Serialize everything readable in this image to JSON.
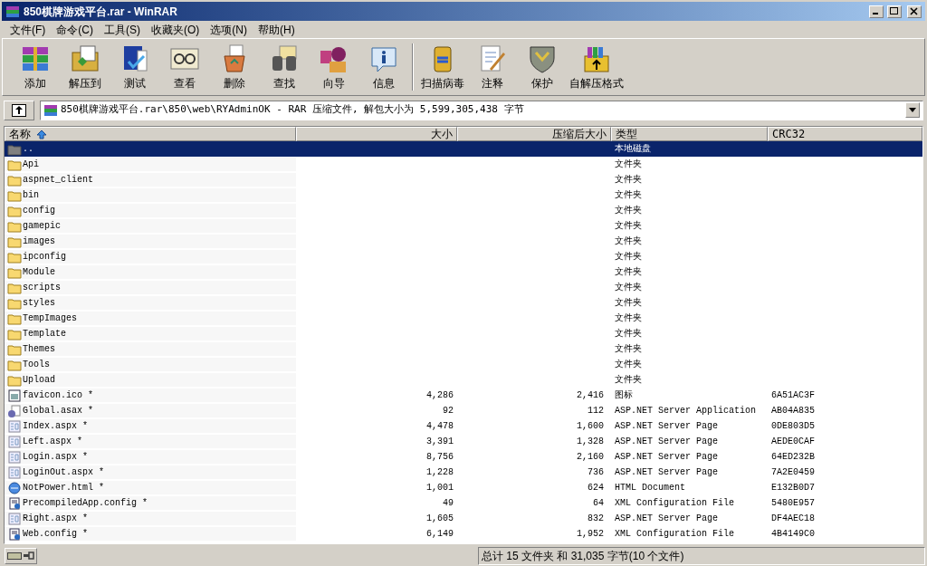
{
  "window": {
    "title": "850棋牌游戏平台.rar - WinRAR"
  },
  "menu": [
    "文件(F)",
    "命令(C)",
    "工具(S)",
    "收藏夹(O)",
    "选项(N)",
    "帮助(H)"
  ],
  "toolbar": [
    [
      {
        "label": "添加",
        "kind": "add"
      },
      {
        "label": "解压到",
        "kind": "extract"
      },
      {
        "label": "测试",
        "kind": "test"
      },
      {
        "label": "查看",
        "kind": "view"
      },
      {
        "label": "删除",
        "kind": "delete"
      },
      {
        "label": "查找",
        "kind": "find"
      },
      {
        "label": "向导",
        "kind": "wizard"
      },
      {
        "label": "信息",
        "kind": "info"
      }
    ],
    [
      {
        "label": "扫描病毒",
        "kind": "scan"
      },
      {
        "label": "注释",
        "kind": "comment"
      },
      {
        "label": "保护",
        "kind": "protect"
      },
      {
        "label": "自解压格式",
        "kind": "sfx"
      }
    ]
  ],
  "path": "850棋牌游戏平台.rar\\850\\web\\RYAdminOK - RAR 压缩文件, 解包大小为 5,599,305,438 字节",
  "table": {
    "columns": [
      "名称",
      "大小",
      "压缩后大小",
      "类型",
      "CRC32"
    ],
    "rows": [
      {
        "kind": "up",
        "name": "..",
        "size": "",
        "packed": "",
        "type": "本地磁盘",
        "crc": "",
        "selected": true
      },
      {
        "kind": "folder",
        "name": "Api",
        "size": "",
        "packed": "",
        "type": "文件夹",
        "crc": "",
        "selected": false
      },
      {
        "kind": "folder",
        "name": "aspnet_client",
        "size": "",
        "packed": "",
        "type": "文件夹",
        "crc": "",
        "selected": false
      },
      {
        "kind": "folder",
        "name": "bin",
        "size": "",
        "packed": "",
        "type": "文件夹",
        "crc": "",
        "selected": false
      },
      {
        "kind": "folder",
        "name": "config",
        "size": "",
        "packed": "",
        "type": "文件夹",
        "crc": "",
        "selected": false
      },
      {
        "kind": "folder",
        "name": "gamepic",
        "size": "",
        "packed": "",
        "type": "文件夹",
        "crc": "",
        "selected": false
      },
      {
        "kind": "folder",
        "name": "images",
        "size": "",
        "packed": "",
        "type": "文件夹",
        "crc": "",
        "selected": false
      },
      {
        "kind": "folder",
        "name": "ipconfig",
        "size": "",
        "packed": "",
        "type": "文件夹",
        "crc": "",
        "selected": false
      },
      {
        "kind": "folder",
        "name": "Module",
        "size": "",
        "packed": "",
        "type": "文件夹",
        "crc": "",
        "selected": false
      },
      {
        "kind": "folder",
        "name": "scripts",
        "size": "",
        "packed": "",
        "type": "文件夹",
        "crc": "",
        "selected": false
      },
      {
        "kind": "folder",
        "name": "styles",
        "size": "",
        "packed": "",
        "type": "文件夹",
        "crc": "",
        "selected": false
      },
      {
        "kind": "folder",
        "name": "TempImages",
        "size": "",
        "packed": "",
        "type": "文件夹",
        "crc": "",
        "selected": false
      },
      {
        "kind": "folder",
        "name": "Template",
        "size": "",
        "packed": "",
        "type": "文件夹",
        "crc": "",
        "selected": false
      },
      {
        "kind": "folder",
        "name": "Themes",
        "size": "",
        "packed": "",
        "type": "文件夹",
        "crc": "",
        "selected": false
      },
      {
        "kind": "folder",
        "name": "Tools",
        "size": "",
        "packed": "",
        "type": "文件夹",
        "crc": "",
        "selected": false
      },
      {
        "kind": "folder",
        "name": "Upload",
        "size": "",
        "packed": "",
        "type": "文件夹",
        "crc": "",
        "selected": false
      },
      {
        "kind": "ico",
        "name": "favicon.ico *",
        "size": "4,286",
        "packed": "2,416",
        "type": "图标",
        "crc": "6A51AC3F",
        "selected": false
      },
      {
        "kind": "asax",
        "name": "Global.asax *",
        "size": "92",
        "packed": "112",
        "type": "ASP.NET Server Application",
        "crc": "AB04A835",
        "selected": false
      },
      {
        "kind": "aspx",
        "name": "Index.aspx *",
        "size": "4,478",
        "packed": "1,600",
        "type": "ASP.NET Server Page",
        "crc": "0DE803D5",
        "selected": false
      },
      {
        "kind": "aspx",
        "name": "Left.aspx *",
        "size": "3,391",
        "packed": "1,328",
        "type": "ASP.NET Server Page",
        "crc": "AEDE0CAF",
        "selected": false
      },
      {
        "kind": "aspx",
        "name": "Login.aspx *",
        "size": "8,756",
        "packed": "2,160",
        "type": "ASP.NET Server Page",
        "crc": "64ED232B",
        "selected": false
      },
      {
        "kind": "aspx",
        "name": "LoginOut.aspx *",
        "size": "1,228",
        "packed": "736",
        "type": "ASP.NET Server Page",
        "crc": "7A2E0459",
        "selected": false
      },
      {
        "kind": "html",
        "name": "NotPower.html *",
        "size": "1,001",
        "packed": "624",
        "type": "HTML Document",
        "crc": "E132B0D7",
        "selected": false
      },
      {
        "kind": "config",
        "name": "PrecompiledApp.config *",
        "size": "49",
        "packed": "64",
        "type": "XML Configuration File",
        "crc": "5480E957",
        "selected": false
      },
      {
        "kind": "aspx",
        "name": "Right.aspx *",
        "size": "1,605",
        "packed": "832",
        "type": "ASP.NET Server Page",
        "crc": "DF4AEC18",
        "selected": false
      },
      {
        "kind": "config",
        "name": "Web.config *",
        "size": "6,149",
        "packed": "1,952",
        "type": "XML Configuration File",
        "crc": "4B4149C0",
        "selected": false
      }
    ]
  },
  "status_bar": "总计 15 文件夹 和 31,035 字节(10 个文件)"
}
